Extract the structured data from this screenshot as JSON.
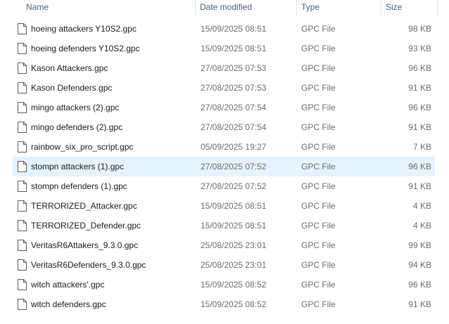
{
  "columns": {
    "name": "Name",
    "date_modified": "Date modified",
    "type": "Type",
    "size": "Size"
  },
  "file_icon": "generic-file-icon",
  "files": [
    {
      "name": "hoeing attackers Y10S2.gpc",
      "date": "15/09/2025 08:51",
      "type": "GPC File",
      "size": "98 KB"
    },
    {
      "name": "hoeing defenders Y10S2.gpc",
      "date": "15/09/2025 08:51",
      "type": "GPC File",
      "size": "93 KB"
    },
    {
      "name": "Kason Attackers.gpc",
      "date": "27/08/2025 07:53",
      "type": "GPC File",
      "size": "96 KB"
    },
    {
      "name": "Kason Defenders.gpc",
      "date": "27/08/2025 07:53",
      "type": "GPC File",
      "size": "91 KB"
    },
    {
      "name": "mingo attackers (2).gpc",
      "date": "27/08/2025 07:54",
      "type": "GPC File",
      "size": "96 KB"
    },
    {
      "name": "mingo defenders (2).gpc",
      "date": "27/08/2025 07:54",
      "type": "GPC File",
      "size": "91 KB"
    },
    {
      "name": "rainbow_six_pro_script.gpc",
      "date": "05/09/2025 19:27",
      "type": "GPC File",
      "size": "7 KB"
    },
    {
      "name": "stompn attackers (1).gpc",
      "date": "27/08/2025 07:52",
      "type": "GPC File",
      "size": "96 KB",
      "hovered": true
    },
    {
      "name": "stompn defenders (1).gpc",
      "date": "27/08/2025 07:52",
      "type": "GPC File",
      "size": "91 KB"
    },
    {
      "name": "TERRORIZED_Attacker.gpc",
      "date": "15/09/2025 08:51",
      "type": "GPC File",
      "size": "4 KB"
    },
    {
      "name": "TERRORIZED_Defender.gpc",
      "date": "15/09/2025 08:51",
      "type": "GPC File",
      "size": "4 KB"
    },
    {
      "name": "VeritasR6Attakers_9.3.0.gpc",
      "date": "25/08/2025 23:01",
      "type": "GPC File",
      "size": "99 KB"
    },
    {
      "name": "VeritasR6Defenders_9.3.0.gpc",
      "date": "25/08/2025 23:01",
      "type": "GPC File",
      "size": "94 KB"
    },
    {
      "name": "witch attackers'.gpc",
      "date": "15/09/2025 08:52",
      "type": "GPC File",
      "size": "96 KB"
    },
    {
      "name": "witch defenders.gpc",
      "date": "15/09/2025 08:52",
      "type": "GPC File",
      "size": "91 KB"
    }
  ],
  "colors": {
    "header_text": "#4c607a",
    "hover_bg": "#e5f3ff",
    "secondary_text": "#6d6d6d"
  }
}
